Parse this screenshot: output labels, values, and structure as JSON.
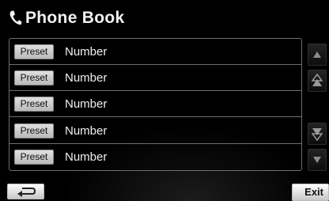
{
  "header": {
    "title": "Phone Book",
    "icon": "phone-handset-icon"
  },
  "entries": [
    {
      "preset_label": "Preset",
      "number": "Number"
    },
    {
      "preset_label": "Preset",
      "number": "Number"
    },
    {
      "preset_label": "Preset",
      "number": "Number"
    },
    {
      "preset_label": "Preset",
      "number": "Number"
    },
    {
      "preset_label": "Preset",
      "number": "Number"
    }
  ],
  "scrollbar": {
    "buttons": [
      "scroll-up-icon",
      "page-up-icon",
      "page-down-icon",
      "scroll-down-icon"
    ]
  },
  "footer": {
    "back_icon": "return-arrow-icon",
    "exit_label": "Exit"
  },
  "colors": {
    "background": "#000000",
    "button_face": "#dcdcdc",
    "border": "#6e6e6e",
    "text": "#f0f0f0"
  }
}
